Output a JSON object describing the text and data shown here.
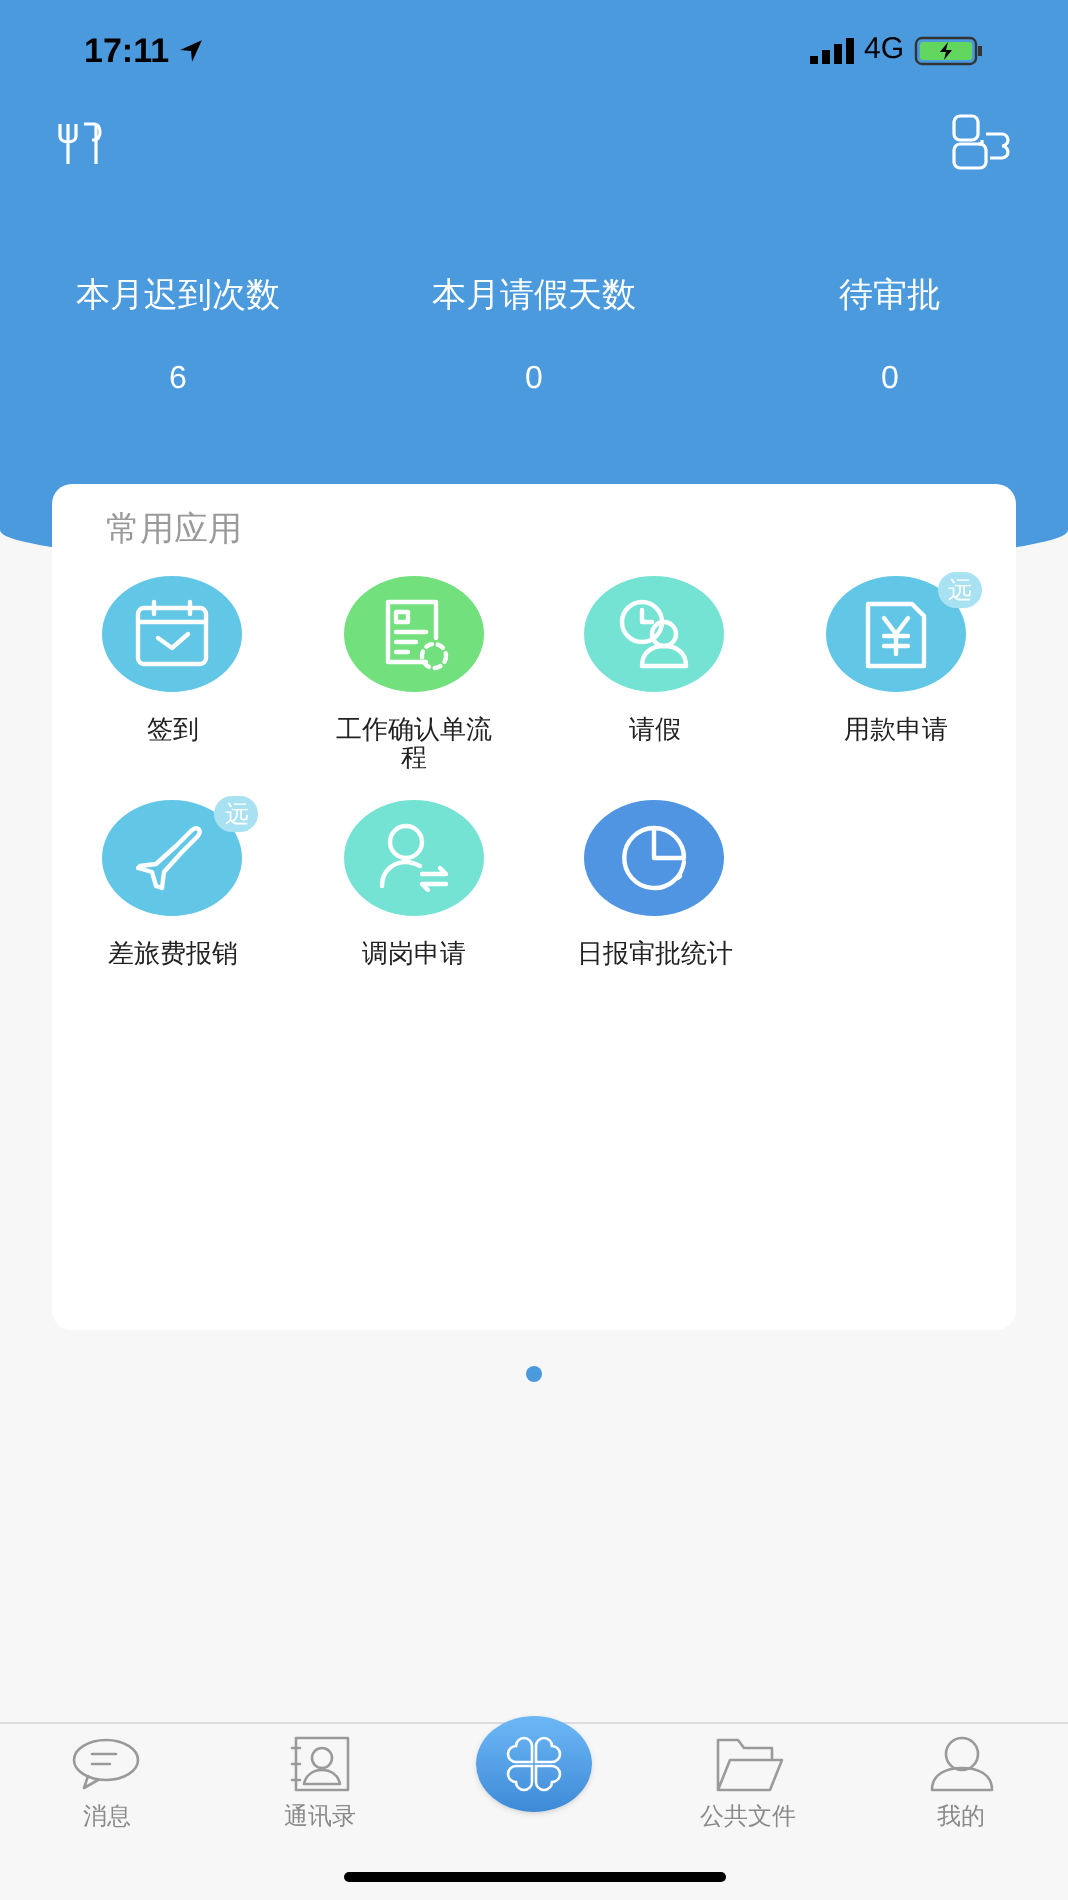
{
  "status_bar": {
    "time": "17:11",
    "network": "4G"
  },
  "stats": [
    {
      "label": "本月迟到次数",
      "value": "6"
    },
    {
      "label": "本月请假天数",
      "value": "0"
    },
    {
      "label": "待审批",
      "value": "0"
    }
  ],
  "apps_card": {
    "title": "常用应用",
    "apps": [
      {
        "kind": "calendar",
        "color": "#62c6e6",
        "label": "签到"
      },
      {
        "kind": "document",
        "color": "#72e07c",
        "label": "工作确认单流程"
      },
      {
        "kind": "leave",
        "color": "#75e3d3",
        "label": "请假"
      },
      {
        "kind": "money",
        "color": "#62c6e6",
        "label": "用款申请",
        "badge": "远"
      },
      {
        "kind": "plane",
        "color": "#62c6e6",
        "label": "差旅费报销",
        "badge": "远"
      },
      {
        "kind": "transfer",
        "color": "#75e3d3",
        "label": "调岗申请"
      },
      {
        "kind": "chart",
        "color": "#4f95e2",
        "label": "日报审批统计"
      }
    ]
  },
  "page_dots": [
    {
      "selected": true
    }
  ],
  "tab_bar": [
    {
      "kind": "chat",
      "label": "消息"
    },
    {
      "kind": "contacts",
      "label": "通讯录"
    },
    {
      "kind": "center"
    },
    {
      "kind": "folder",
      "label": "公共文件"
    },
    {
      "kind": "person",
      "label": "我的"
    }
  ]
}
